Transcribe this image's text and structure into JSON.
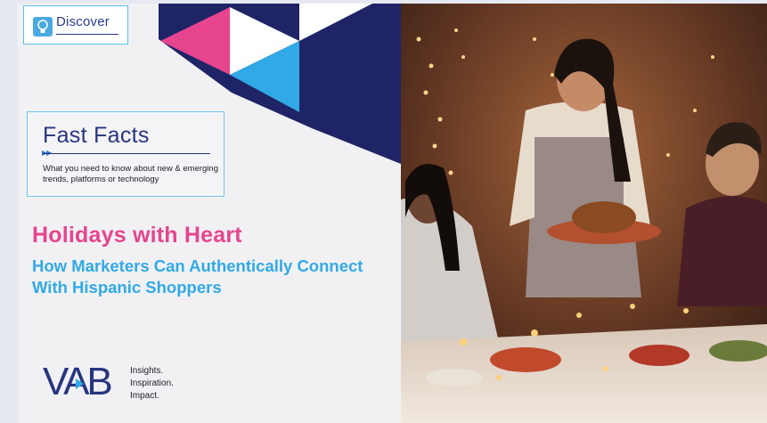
{
  "discover": {
    "label": "Discover"
  },
  "fast_facts": {
    "title": "Fast Facts",
    "arrows": "▶▶",
    "description": "What you need to know about new & emerging trends, platforms or technology"
  },
  "headline": {
    "title": "Holidays with Heart",
    "subtitle": "How Marketers Can Authentically Connect With Hispanic Shoppers"
  },
  "logo": {
    "wordmark": "VAB",
    "tagline_1": "Insights.",
    "tagline_2": "Inspiration.",
    "tagline_3": "Impact."
  },
  "colors": {
    "navy": "#27357e",
    "pink": "#e6458e",
    "sky": "#31a9e6",
    "dark_navy": "#1f2466"
  },
  "icons": [
    "lightbulb-icon",
    "double-arrow-icon"
  ]
}
